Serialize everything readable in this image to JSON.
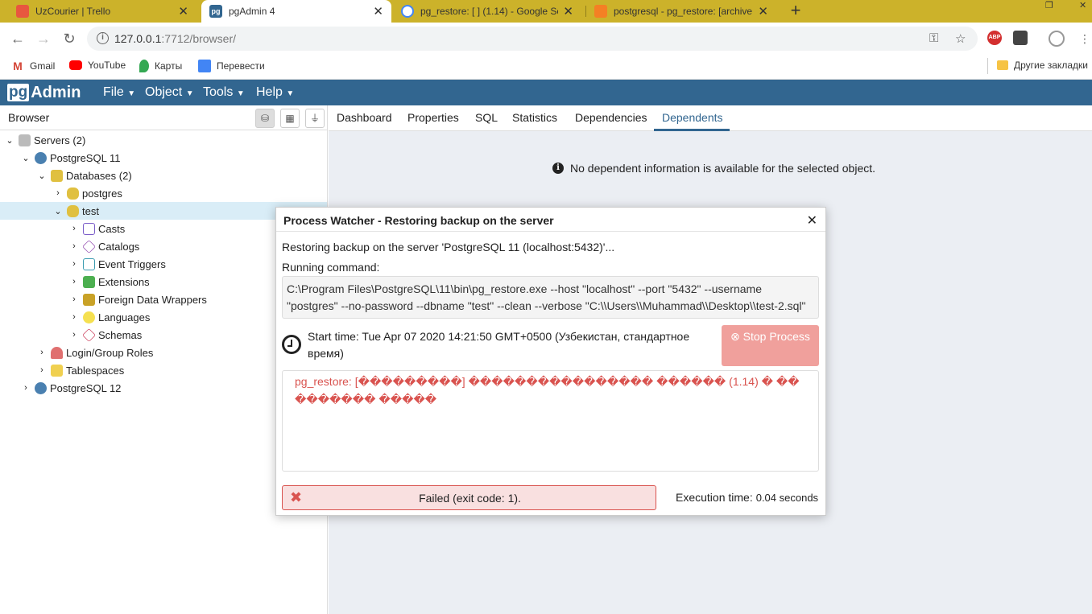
{
  "chrome": {
    "tabs": [
      {
        "label": "UzCourier | Trello",
        "icon": "trello-icon"
      },
      {
        "label": "pgAdmin 4",
        "icon": "pgadmin-icon"
      },
      {
        "label": "pg_restore: [ ] (1.14) - Google Se",
        "icon": "google-icon"
      },
      {
        "label": "postgresql - pg_restore: [archive",
        "icon": "stackoverflow-icon"
      }
    ],
    "url_host": "127.0.0.1",
    "url_path": ":7712/browser/",
    "bookmarks": [
      "Gmail",
      "YouTube",
      "Карты",
      "Перевести"
    ],
    "other_bookmarks": "Другие закладки"
  },
  "pgadmin": {
    "logo_pg": "pg",
    "logo_admin": "Admin",
    "menus": [
      "File",
      "Object",
      "Tools",
      "Help"
    ]
  },
  "browser": {
    "title": "Browser",
    "tree": [
      {
        "label": "Servers (2)"
      },
      {
        "label": "PostgreSQL 11"
      },
      {
        "label": "Databases (2)"
      },
      {
        "label": "postgres"
      },
      {
        "label": "test"
      },
      {
        "label": "Casts"
      },
      {
        "label": "Catalogs"
      },
      {
        "label": "Event Triggers"
      },
      {
        "label": "Extensions"
      },
      {
        "label": "Foreign Data Wrappers"
      },
      {
        "label": "Languages"
      },
      {
        "label": "Schemas"
      },
      {
        "label": "Login/Group Roles"
      },
      {
        "label": "Tablespaces"
      },
      {
        "label": "PostgreSQL 12"
      }
    ]
  },
  "main": {
    "tabs": [
      "Dashboard",
      "Properties",
      "SQL",
      "Statistics",
      "Dependencies",
      "Dependents"
    ],
    "active_tab": "Dependents",
    "info": "No dependent information is available for the selected object."
  },
  "dialog": {
    "title": "Process Watcher - Restoring backup on the server",
    "status": "Restoring backup on the server 'PostgreSQL 11 (localhost:5432)'...",
    "running_label": "Running command:",
    "command": "C:\\Program Files\\PostgreSQL\\11\\bin\\pg_restore.exe --host \"localhost\" --port \"5432\" --username \"postgres\" --no-password --dbname \"test\" --clean --verbose \"C:\\\\Users\\\\Muhammad\\\\Desktop\\\\test-2.sql\"",
    "start_time": "Start time: Tue Apr 07 2020 14:21:50 GMT+0500 (Узбекистан, стандартное время)",
    "stop_button": "Stop Process",
    "log": "pg_restore: [���������] ���������������� ������ (1.14) � ��������� �����",
    "failed": "Failed (exit code: 1).",
    "exec_label": "Execution time:",
    "exec_value": "0.04 seconds"
  },
  "colors": {
    "pgadmin_nav": "#326690",
    "tabstrip": "#ccb22a",
    "error": "#d9534f",
    "stop_button": "#f0a09c",
    "selected_row": "#d9edf7"
  }
}
